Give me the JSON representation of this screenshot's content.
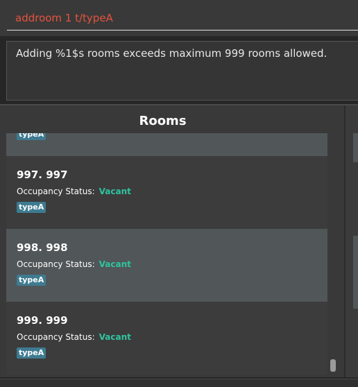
{
  "command": {
    "value": "addroom 1 t/typeA"
  },
  "result": {
    "message": "Adding %1$s rooms exceeds maximum 999 rooms allowed."
  },
  "rooms_panel": {
    "title": "Rooms",
    "cards": [
      {
        "title": "",
        "status_label": "",
        "status_value": "",
        "tag": "typeA"
      },
      {
        "title": "997.  997",
        "status_label": "Occupancy Status:",
        "status_value": "Vacant",
        "tag": "typeA"
      },
      {
        "title": "998.  998",
        "status_label": "Occupancy Status:",
        "status_value": "Vacant",
        "tag": "typeA"
      },
      {
        "title": "999.  999",
        "status_label": "Occupancy Status:",
        "status_value": "Vacant",
        "tag": "typeA"
      }
    ]
  },
  "colors": {
    "command_text": "#e5533d",
    "vacant": "#2ec4a0",
    "tag_bg": "#3e7b91"
  }
}
